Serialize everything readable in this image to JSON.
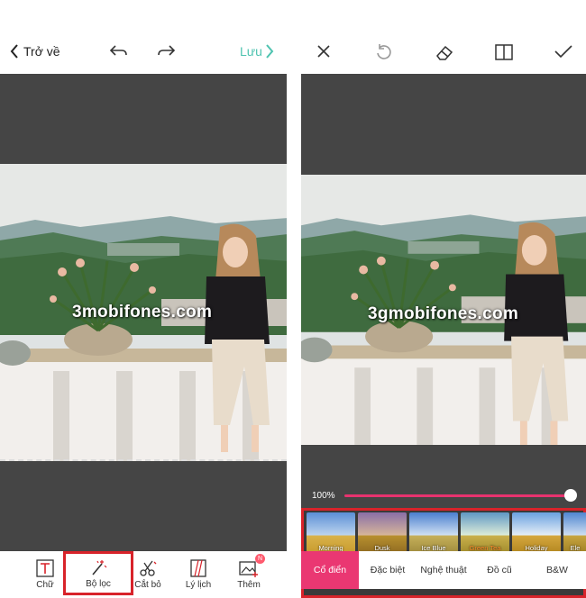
{
  "left_panel": {
    "back_label": "Trở về",
    "save_label": "Lưu",
    "watermark": "3mobifones.com",
    "tools": [
      {
        "id": "text",
        "label": "Chữ"
      },
      {
        "id": "filter",
        "label": "Bộ lọc"
      },
      {
        "id": "crop",
        "label": "Cắt bỏ"
      },
      {
        "id": "retro",
        "label": "Lý lịch"
      },
      {
        "id": "more",
        "label": "Thêm",
        "badge": "N"
      }
    ]
  },
  "right_panel": {
    "watermark": "3gmobifones.com",
    "intensity": "100%",
    "intensity_level": 1.0,
    "filters": [
      {
        "label": "Morning",
        "active": false
      },
      {
        "label": "Dusk",
        "active": false
      },
      {
        "label": "Ice Blue",
        "active": false
      },
      {
        "label": "Green Tea",
        "active": true
      },
      {
        "label": "Holiday",
        "active": false
      },
      {
        "label": "Ele",
        "active": false
      }
    ],
    "categories": [
      {
        "label": "Cổ điển",
        "active": true
      },
      {
        "label": "Đặc biệt",
        "active": false
      },
      {
        "label": "Nghệ thuật",
        "active": false
      },
      {
        "label": "Đồ cũ",
        "active": false
      },
      {
        "label": "B&W",
        "active": false
      }
    ]
  },
  "colors": {
    "accent_teal": "#4ec3b0",
    "accent_pink": "#ea3772",
    "highlight_red": "#d8232a",
    "canvas_gray": "#454545"
  }
}
